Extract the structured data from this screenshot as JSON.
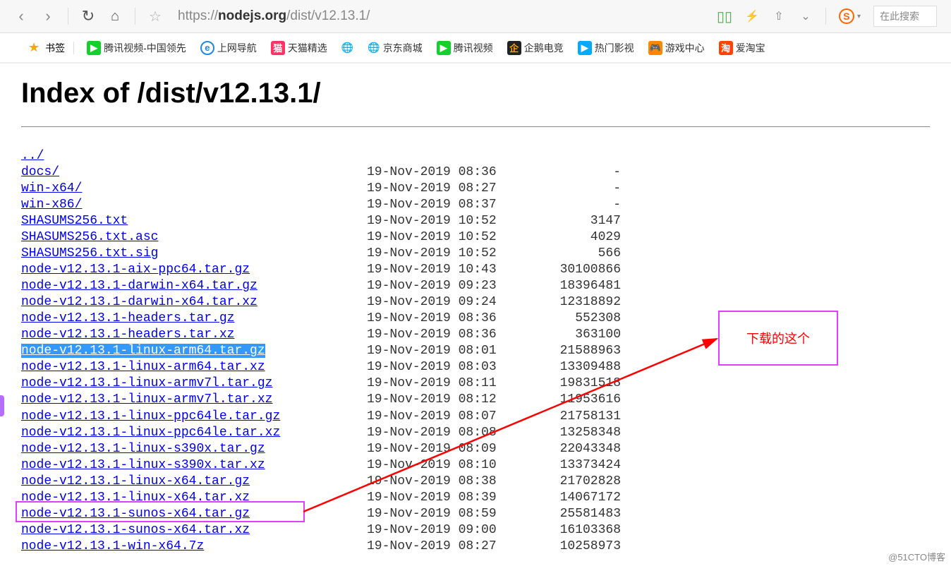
{
  "url": {
    "protocol": "https://",
    "domain": "nodejs.org",
    "path": "/dist/v12.13.1/"
  },
  "right": {
    "search_placeholder": "在此搜索"
  },
  "bookmarks": {
    "label": "书签",
    "items": [
      "腾讯视频-中国领先",
      "上网导航",
      "天猫精选",
      "京东商城",
      "腾讯视频",
      "企鹅电竞",
      "热门影视",
      "游戏中心",
      "爱淘宝"
    ]
  },
  "page": {
    "title": "Index of /dist/v12.13.1/",
    "parent": "../",
    "files": [
      {
        "name": "docs/",
        "date": "19-Nov-2019 08:36",
        "size": "-"
      },
      {
        "name": "win-x64/",
        "date": "19-Nov-2019 08:27",
        "size": "-"
      },
      {
        "name": "win-x86/",
        "date": "19-Nov-2019 08:37",
        "size": "-"
      },
      {
        "name": "SHASUMS256.txt",
        "date": "19-Nov-2019 10:52",
        "size": "3147"
      },
      {
        "name": "SHASUMS256.txt.asc",
        "date": "19-Nov-2019 10:52",
        "size": "4029"
      },
      {
        "name": "SHASUMS256.txt.sig",
        "date": "19-Nov-2019 10:52",
        "size": "566"
      },
      {
        "name": "node-v12.13.1-aix-ppc64.tar.gz",
        "date": "19-Nov-2019 10:43",
        "size": "30100866"
      },
      {
        "name": "node-v12.13.1-darwin-x64.tar.gz",
        "date": "19-Nov-2019 09:23",
        "size": "18396481"
      },
      {
        "name": "node-v12.13.1-darwin-x64.tar.xz",
        "date": "19-Nov-2019 09:24",
        "size": "12318892"
      },
      {
        "name": "node-v12.13.1-headers.tar.gz",
        "date": "19-Nov-2019 08:36",
        "size": "552308"
      },
      {
        "name": "node-v12.13.1-headers.tar.xz",
        "date": "19-Nov-2019 08:36",
        "size": "363100"
      },
      {
        "name": "node-v12.13.1-linux-arm64.tar.gz",
        "date": "19-Nov-2019 08:01",
        "size": "21588963",
        "highlighted": true
      },
      {
        "name": "node-v12.13.1-linux-arm64.tar.xz",
        "date": "19-Nov-2019 08:03",
        "size": "13309488"
      },
      {
        "name": "node-v12.13.1-linux-armv7l.tar.gz",
        "date": "19-Nov-2019 08:11",
        "size": "19831518"
      },
      {
        "name": "node-v12.13.1-linux-armv7l.tar.xz",
        "date": "19-Nov-2019 08:12",
        "size": "11953616"
      },
      {
        "name": "node-v12.13.1-linux-ppc64le.tar.gz",
        "date": "19-Nov-2019 08:07",
        "size": "21758131"
      },
      {
        "name": "node-v12.13.1-linux-ppc64le.tar.xz",
        "date": "19-Nov-2019 08:08",
        "size": "13258348"
      },
      {
        "name": "node-v12.13.1-linux-s390x.tar.gz",
        "date": "19-Nov-2019 08:09",
        "size": "22043348"
      },
      {
        "name": "node-v12.13.1-linux-s390x.tar.xz",
        "date": "19-Nov-2019 08:10",
        "size": "13373424"
      },
      {
        "name": "node-v12.13.1-linux-x64.tar.gz",
        "date": "19-Nov-2019 08:38",
        "size": "21702828"
      },
      {
        "name": "node-v12.13.1-linux-x64.tar.xz",
        "date": "19-Nov-2019 08:39",
        "size": "14067172"
      },
      {
        "name": "node-v12.13.1-sunos-x64.tar.gz",
        "date": "19-Nov-2019 08:59",
        "size": "25581483"
      },
      {
        "name": "node-v12.13.1-sunos-x64.tar.xz",
        "date": "19-Nov-2019 09:00",
        "size": "16103368"
      },
      {
        "name": "node-v12.13.1-win-x64.7z",
        "date": "19-Nov-2019 08:27",
        "size": "10258973"
      }
    ]
  },
  "annotation": {
    "label": "下载的这个"
  },
  "watermark": "@51CTO博客"
}
